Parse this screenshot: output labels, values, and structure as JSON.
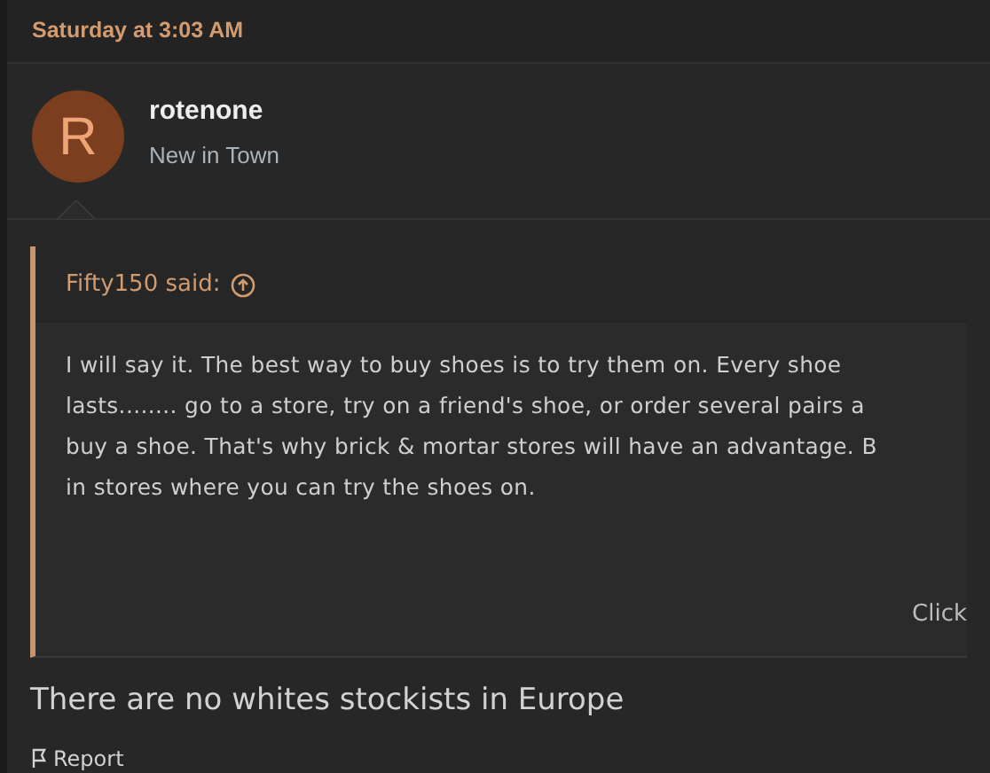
{
  "post_date": "Saturday at 3:03 AM",
  "author": {
    "initial": "R",
    "name": "rotenone",
    "title": "New in Town"
  },
  "quote": {
    "attribution": "Fifty150 said:",
    "lines": [
      "I will say it. The best way to buy shoes is to try them on. Every shoe",
      "lasts........ go to a store, try on a friend's shoe, or order several pairs a",
      "buy a shoe. That's why brick & mortar stores will have an advantage. B",
      "in stores where you can try the shoes on."
    ],
    "expand": "Click"
  },
  "message": "There are no whites stockists in Europe",
  "actions": [
    "Report"
  ]
}
